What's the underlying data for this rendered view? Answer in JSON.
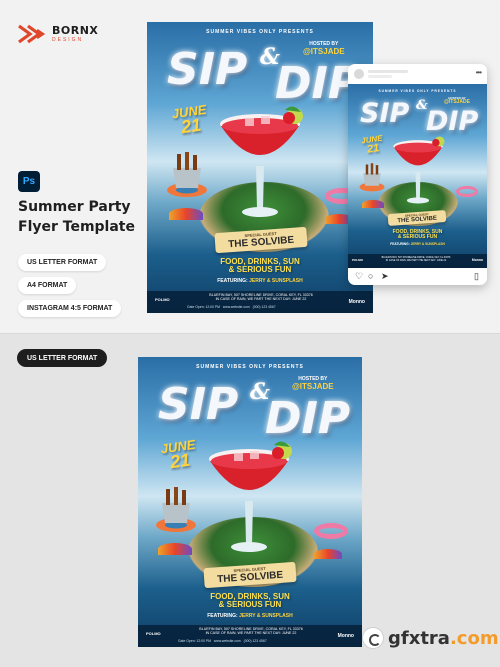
{
  "brand": {
    "name": "BORNX",
    "sub": "DESIGN",
    "accent": "#e0462c"
  },
  "app_badge": {
    "label": "Ps",
    "icon": "photoshop-icon"
  },
  "product_title": [
    "Summer Party",
    "Flyer Template"
  ],
  "formats": [
    "US LETTER FORMAT",
    "A4 FORMAT",
    "INSTAGRAM 4:5 FORMAT"
  ],
  "bottom_label": "US LETTER FORMAT",
  "flyer": {
    "top_line": "SUMMER VIBES ONLY PRESENTS",
    "title_1": "SIP",
    "amp": "&",
    "title_2": "DIP",
    "hosted_label": "HOSTED BY",
    "hosted_by": "@ITSJADE",
    "date_month": "JUNE",
    "date_day": "21",
    "special_guest": "SPECIAL GUEST",
    "guest_name": "THE SOLVIBE",
    "tagline_1": "FOOD, DRINKS, SUN",
    "tagline_2": "& SERIOUS FUN",
    "featuring_label": "FEATURING:",
    "featuring_names": "JERRY & SUNSPLASH",
    "address_1": "BLUEFIN BAY, 507 SHORELINE DRIVE, CORAL KEY, FL 33376",
    "address_2": "IN CASE OF RAIN, WE PART THE NEXT DAY: JUNE 22",
    "gate_open": "Gate Open: 12:00 PM",
    "website": "www.website.com",
    "phone": "(000) 123 4567",
    "logo_left": "POLMO",
    "logo_right": "Monno"
  },
  "watermark": {
    "text": "gfxtra",
    "suffix": ".com"
  }
}
